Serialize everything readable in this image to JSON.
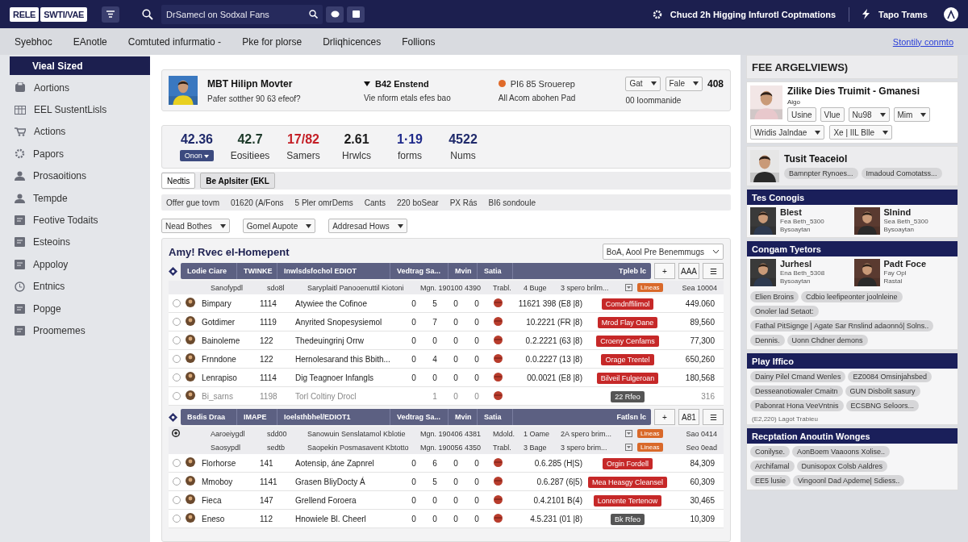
{
  "topbar": {
    "logo": [
      "RELE",
      "SWTI/VAE"
    ],
    "search": {
      "value": "DrSamecl on Sodxal Fans"
    },
    "notice": "Chucd 2h Higging Infurotl Coptmations",
    "team": "Tapo Trams"
  },
  "subnav": {
    "tabs": [
      "Syebhoc",
      "EAnotle",
      "Comtuted infurmatio -",
      "Pke for plorse",
      "Drliqhicences",
      "Follions"
    ],
    "link": "Stontily conmto"
  },
  "sidebar": {
    "items": [
      {
        "label": "Vieal Sized",
        "selected": true
      },
      {
        "label": "Aortions",
        "selected": false
      },
      {
        "label": "EEL SustentLisls",
        "selected": false
      },
      {
        "label": "Actions",
        "selected": false
      },
      {
        "label": "Papors",
        "selected": false
      },
      {
        "label": "Prosaoitions",
        "selected": false
      },
      {
        "label": "Tempde",
        "selected": false
      },
      {
        "label": "Feotive Todaits",
        "selected": false
      },
      {
        "label": "Esteoins",
        "selected": false
      },
      {
        "label": "Appoloy",
        "selected": false
      },
      {
        "label": "Entnics",
        "selected": false
      },
      {
        "label": "Popge",
        "selected": false
      },
      {
        "label": "Proomemes",
        "selected": false
      }
    ]
  },
  "profile": {
    "name": "MBT Hilipn Movter",
    "subtitle": "Pafer sotther 90 63 efeof?",
    "status": "B42 Enstend",
    "status_note": "Vie nform etals efes bao",
    "team": "PI6 85 Srouerep",
    "team_note": "All Acom abohen Pad",
    "selects": [
      "Gat",
      "Fale"
    ],
    "total": "408",
    "total_note": "00 Ioommanide"
  },
  "stats": [
    {
      "value": "42.36",
      "label": "Onon",
      "kind": "badge",
      "color": "#1f2a6b"
    },
    {
      "value": "42.7",
      "label": "Eositiees",
      "kind": "label",
      "color": "#1d3a2a"
    },
    {
      "value": "17/82",
      "label": "Samers",
      "kind": "label",
      "color": "#c41f26"
    },
    {
      "value": "2.61",
      "label": "Hrwlcs",
      "kind": "label",
      "color": "#1a1a1a"
    },
    {
      "value": "1·19",
      "label": "forms",
      "kind": "label",
      "color": "#1f2a8b"
    },
    {
      "value": "4522",
      "label": "Nums",
      "kind": "label",
      "color": "#1f2a6b"
    }
  ],
  "actions": [
    {
      "label": "Nedtis",
      "selected": false
    },
    {
      "label": "Be Aplsiter (EKL",
      "selected": true
    }
  ],
  "info": [
    "Offer gue tovm",
    "01620 (A/Fons",
    "5 Pler omrDems",
    "Cants",
    "220 boSear",
    "PX Rás",
    "BI6 sondoule"
  ],
  "filters": [
    "Nead Bothes",
    "Gomel Aupote",
    "Addresad Hows"
  ],
  "table": {
    "title": "Amy! Rvec el-Homepent",
    "view": "BoA, Aool Pre Benemmugs",
    "groups": [
      {
        "header": [
          "Lodie Ciare",
          "TWINKE",
          "Inwlsdsfochol EDIOT",
          "Vedtrag Sa...",
          "Mvin",
          "Satia",
          "Tpleb lc"
        ],
        "tools": [
          "+",
          "AAA",
          "☰"
        ],
        "subheaders": [
          {
            "radio": false,
            "cells": [
              "Sanofypdl",
              "sdo8l",
              "Saryplaitl Panooenuttil Kiotoni",
              "Mgn. 190100 4390",
              "Trabl.",
              "4 Buge",
              "3 spero brilm...",
              "Lineas",
              "Sea 10004"
            ]
          }
        ],
        "rows": [
          {
            "selected": false,
            "disabled": false,
            "name": "Bimpary",
            "id": "1114",
            "title": "Atywiee the Cofinoe",
            "n": [
              "0",
              "5",
              "0",
              "0"
            ],
            "value": "11621 398 (E8 |8)",
            "tag": "Comdnffilimol",
            "color": "#c62828",
            "amount": "449.060"
          },
          {
            "selected": false,
            "disabled": false,
            "name": "Gotdimer",
            "id": "1119",
            "title": "Anyrited Snopesysiemol",
            "n": [
              "0",
              "7",
              "0",
              "0"
            ],
            "value": "10.2221 (FR |8)",
            "tag": "Mrod Flay Oane",
            "color": "#c62828",
            "amount": "89,560"
          },
          {
            "selected": false,
            "disabled": false,
            "name": "Bainoleme",
            "id": "122",
            "title": "Thedeuingrinj Orrw",
            "n": [
              "0",
              "0",
              "0",
              "0"
            ],
            "value": "0.2.2221 (63 |8)",
            "tag": "Croeny Cenfams",
            "color": "#c62828",
            "amount": "77,300"
          },
          {
            "selected": false,
            "disabled": false,
            "name": "Frnndone",
            "id": "122",
            "title": "Hernolesarand this Bbith...",
            "n": [
              "0",
              "4",
              "0",
              "0"
            ],
            "value": "0.0.2227 (13 |8)",
            "tag": "Orage Trentel",
            "color": "#c62828",
            "amount": "650,260"
          },
          {
            "selected": false,
            "disabled": false,
            "name": "Lenrapiso",
            "id": "1114",
            "title": "Dig Teagnoer Infangls",
            "n": [
              "0",
              "0",
              "0",
              "0"
            ],
            "value": "00.0021 (E8 |8)",
            "tag": "Bilveil Fulgeroan",
            "color": "#c62828",
            "amount": "180,568"
          },
          {
            "selected": false,
            "disabled": true,
            "name": "Bi_sarns",
            "id": "1198",
            "title": "Torl Coltiny Drocl",
            "n": [
              "1",
              "0",
              "0"
            ],
            "tag": "22 Rfeo",
            "color": "#555555",
            "amount": "316"
          }
        ]
      },
      {
        "header": [
          "Bsdis Draa",
          "IMAPE",
          "Ioelsthbhel/EDIOT1",
          "Vedtrag Sa...",
          "Mvin",
          "Satia",
          "Fatlsn lc"
        ],
        "tools": [
          "+",
          "A81",
          "☰"
        ],
        "subheaders": [
          {
            "radio": true,
            "cells": [
              "Aaroeiygdl",
              "sdd00",
              "Sanowuin Senslatamol Kblotie",
              "Mgn. 190406 4381",
              "Mdold.",
              "1 Oame",
              "2A spero brim...",
              "Lineas",
              "Sao 0414"
            ]
          },
          {
            "radio": false,
            "cells": [
              "Saosypdl",
              "sedtb",
              "Saopekin Posmasavent Kbtotto",
              "Mgn. 190056 4350",
              "Trabl.",
              "3 Bage",
              "3 spero brim...",
              "Lineas",
              "Seo 0ead"
            ]
          }
        ],
        "rows": [
          {
            "selected": false,
            "disabled": false,
            "name": "Florhorse",
            "id": "141",
            "title": "Aotensip, áne Zapnrel",
            "n": [
              "0",
              "6",
              "0",
              "0"
            ],
            "value": "0.6.285 (H|S)",
            "tag": "Orgin Fordell",
            "color": "#c62828",
            "amount": "84,309"
          },
          {
            "selected": false,
            "disabled": false,
            "name": "Mmoboy",
            "id": "1141",
            "title": "Grasen BliyDocty Á",
            "n": [
              "0",
              "5",
              "0",
              "0"
            ],
            "value": "0.6.287 (6|5)",
            "tag": "Mea Heasgy Cleansel",
            "color": "#c62828",
            "amount": "60,309"
          },
          {
            "selected": false,
            "disabled": false,
            "name": "Fieca",
            "id": "147",
            "title": "Grellend Foroera",
            "n": [
              "0",
              "0",
              "0",
              "0"
            ],
            "value": "0.4.2101 B(4)",
            "tag": "Lonrente Tertenow",
            "color": "#c62828",
            "amount": "30,465"
          },
          {
            "selected": false,
            "disabled": false,
            "name": "Eneso",
            "id": "112",
            "title": "Hnowiele Bl. Cheerl",
            "n": [
              "0",
              "0",
              "0",
              "0"
            ],
            "value": "4.5.231 (01 |8)",
            "tag": "Bk Rfeo",
            "color": "#555555",
            "amount": "10,309"
          }
        ]
      }
    ]
  },
  "right": {
    "title": "FEE ARGELVIEWS)",
    "feature": {
      "kind": "picture",
      "title": "Zilike Dies Truimit - Gmanesi",
      "subtitle": "Aigo",
      "buttons": [
        {
          "label": "Usine",
          "dropdown": false
        },
        {
          "label": "Vlue",
          "dropdown": false
        },
        {
          "label": "Nu98",
          "dropdown": true
        },
        {
          "label": "Mim",
          "dropdown": true
        }
      ],
      "selects": [
        "Wridis Jalndae",
        "Xe | IIL Blle"
      ]
    },
    "contact": {
      "name": "Tusit Teaceiol",
      "pills": [
        "Bamnpter Rynoes...",
        "Imadoud Comotatss..."
      ]
    },
    "sections": [
      {
        "title": "Tes Conogis",
        "people": [
          {
            "name": "Blest",
            "line1": "Fea Beth_5300",
            "line2": "Bysoaytan"
          },
          {
            "name": "Slnind",
            "line1": "Sea Beth_5300",
            "line2": "Bysoaytan"
          }
        ]
      },
      {
        "title": "Congam Tyetors",
        "people": [
          {
            "name": "Jurhesl",
            "line1": "Ena Beth_5308",
            "line2": "Bysoaytan"
          },
          {
            "name": "Padt Foce",
            "line1": "Fay Opl",
            "line2": "Rastal"
          }
        ],
        "pill_rows": [
          [
            "Elien Broins",
            "Cdbio leefipeonter joolnleine"
          ],
          [
            "Onoler lad Setaot:"
          ],
          [
            "Fathal PitSignge | Agate Sar Rnslind adaonnó| Solns.."
          ],
          [
            "Dennis.",
            "Uonn Chdner demons"
          ]
        ]
      },
      {
        "title": "Play Iffico",
        "pill_rows": [
          [
            "Dainy Pilel Cmand Wenles",
            "EZ0084 Omsinjahsbed"
          ],
          [
            "Desseanotiowaler Cmaitn",
            "GUN Disbolit sasury"
          ],
          [
            "Pabonrat Hona VeeVntnis",
            "ECSBNG Seloors..."
          ]
        ],
        "note": "(E2,220) Lagot Trabieu"
      },
      {
        "title": "Recptation Anoutin Wonges",
        "pill_rows": [
          [
            "Conilyse.",
            "AonBoem Vaaoons Xolise.."
          ],
          [
            "Archifamal",
            "Dunisopox Colsb Aaldres"
          ],
          [
            "EE5 lusie",
            "Vingoonl Dad Apdeme| Sdiess.."
          ]
        ]
      }
    ]
  }
}
